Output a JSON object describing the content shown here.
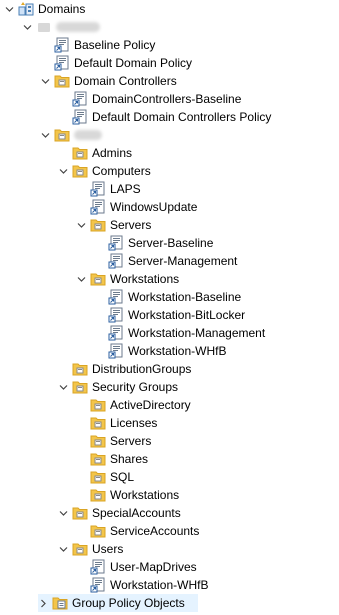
{
  "tree": {
    "root_label": "Domains",
    "domain_label": "",
    "domain_policies": [
      "Baseline Policy",
      "Default Domain Policy"
    ],
    "domain_controllers": {
      "label": "Domain Controllers",
      "policies": [
        "DomainControllers-Baseline",
        "Default Domain Controllers Policy"
      ]
    },
    "org_label": "",
    "admins": "Admins",
    "computers": {
      "label": "Computers",
      "policies": [
        "LAPS",
        "WindowsUpdate"
      ],
      "servers": {
        "label": "Servers",
        "policies": [
          "Server-Baseline",
          "Server-Management"
        ]
      },
      "workstations": {
        "label": "Workstations",
        "policies": [
          "Workstation-Baseline",
          "Workstation-BitLocker",
          "Workstation-Management",
          "Workstation-WHfB"
        ]
      }
    },
    "distribution_groups": "DistributionGroups",
    "security_groups": {
      "label": "Security Groups",
      "children": [
        "ActiveDirectory",
        "Licenses",
        "Servers",
        "Shares",
        "SQL",
        "Workstations"
      ]
    },
    "special_accounts": {
      "label": "SpecialAccounts",
      "children": [
        "ServiceAccounts"
      ]
    },
    "users": {
      "label": "Users",
      "policies": [
        "User-MapDrives",
        "Workstation-WHfB"
      ]
    },
    "gpo_container": "Group Policy Objects"
  },
  "icons": {
    "domains": "domains-icon",
    "domain": "domain-icon",
    "ou": "ou-folder-icon",
    "gpo_link": "gpo-link-icon",
    "gpo_container": "gpo-folder-icon"
  },
  "colors": {
    "selection": "#e5f3ff",
    "folder": "#f3c54a",
    "folder_dark": "#d9a424"
  }
}
